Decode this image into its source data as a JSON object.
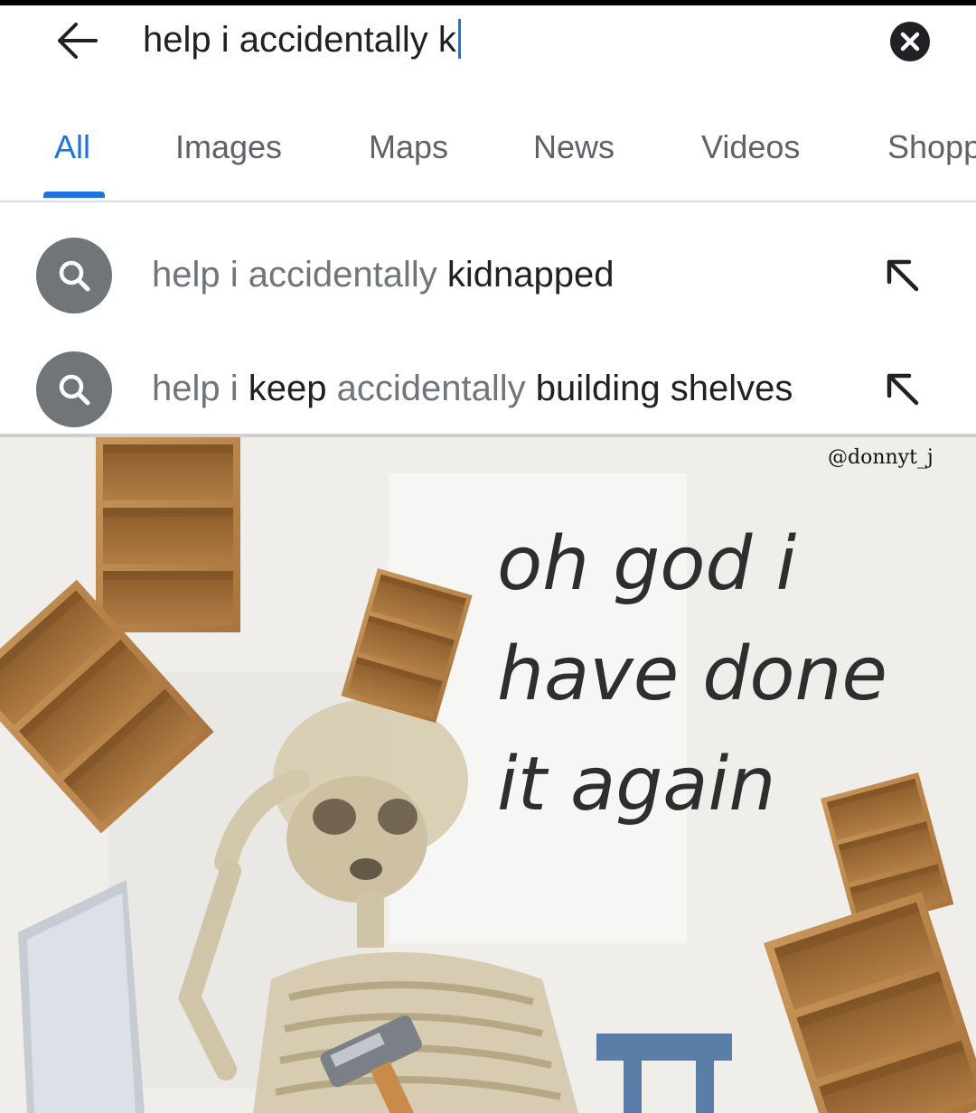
{
  "search": {
    "query": "help i accidentally k",
    "back_icon": "arrow-left-icon",
    "clear_icon": "close-circle-icon"
  },
  "tabs": [
    {
      "label": "All",
      "active": true
    },
    {
      "label": "Images",
      "active": false
    },
    {
      "label": "Maps",
      "active": false
    },
    {
      "label": "News",
      "active": false
    },
    {
      "label": "Videos",
      "active": false
    },
    {
      "label": "Shopp",
      "active": false
    }
  ],
  "suggestions": [
    {
      "prefix": "help i accidentally ",
      "completion": "kidnapped",
      "icon": "search-icon",
      "action_icon": "arrow-up-left-icon"
    },
    {
      "prefix": "help i ",
      "match": "keep",
      "middle": " accidentally ",
      "completion": "building shelves",
      "icon": "search-icon",
      "action_icon": "arrow-up-left-icon"
    }
  ],
  "meme": {
    "watermark": "@donnyt_j",
    "caption": [
      "oh god i",
      "have done",
      "it again"
    ]
  },
  "colors": {
    "accent": "#1a73e8",
    "text_primary": "#202124",
    "text_secondary": "#70757a"
  }
}
